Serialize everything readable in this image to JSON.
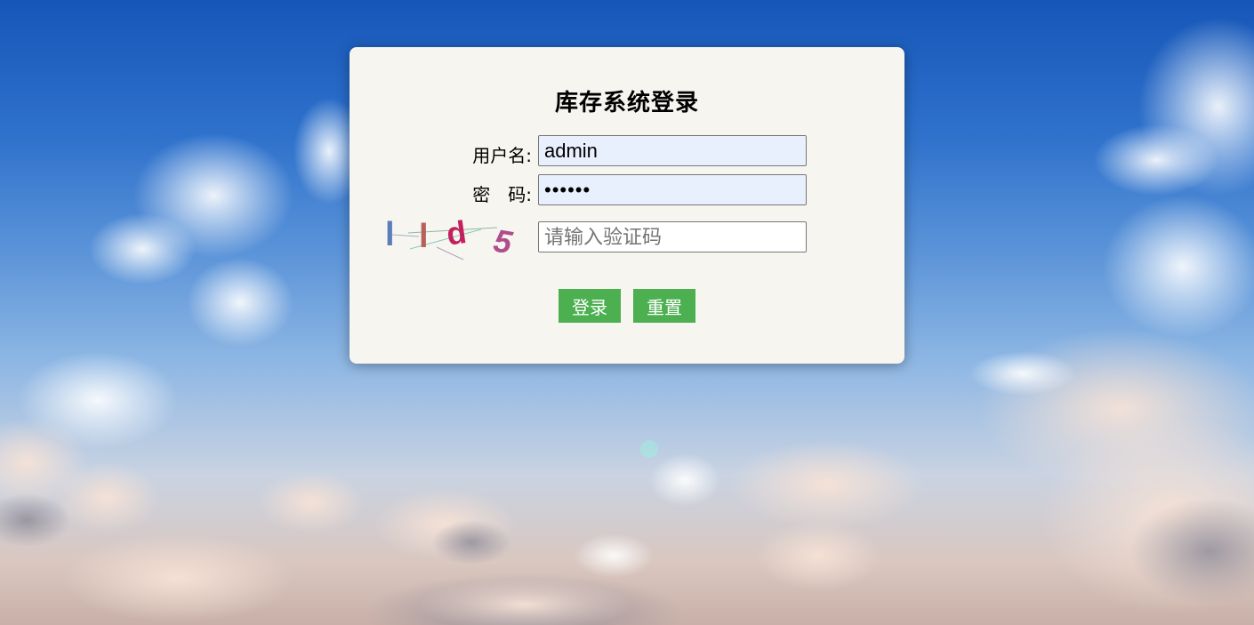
{
  "login": {
    "title": "库存系统登录",
    "username_label": "用户名:",
    "username_value": "admin",
    "password_label": "密　码:",
    "password_value": "••••••",
    "captcha_placeholder": "请输入验证码",
    "captcha_text": [
      "l",
      "l",
      "d",
      "5"
    ],
    "login_button": "登录",
    "reset_button": "重置"
  },
  "colors": {
    "button": "#4caf50",
    "panel": "#f7f5ef",
    "autofill": "#e8f0fe"
  }
}
